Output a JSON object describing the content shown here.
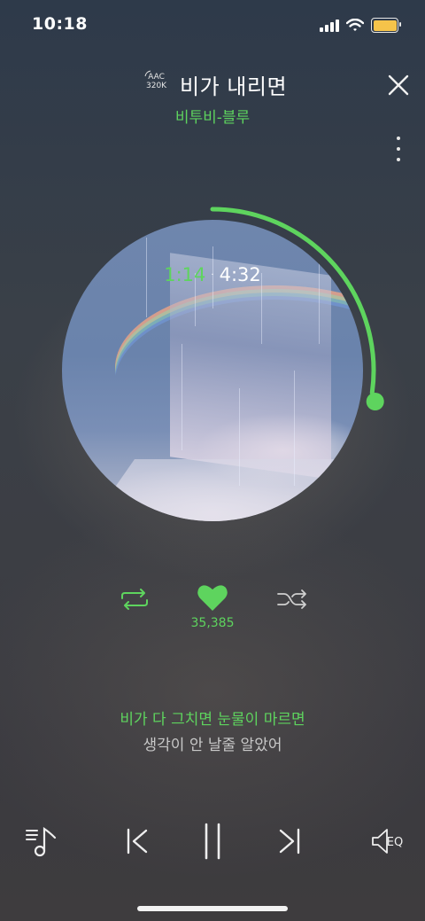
{
  "status_bar": {
    "time": "10:18",
    "battery_color": "#f5c34a"
  },
  "header": {
    "quality_codec": "AAC",
    "quality_bitrate": "320K",
    "song_title": "비가 내리면",
    "artist": "비투비-블루"
  },
  "player": {
    "current_time": "1:14",
    "separator": "·",
    "total_time": "4:32",
    "progress_fraction": 0.272,
    "accent_color": "#5ed45e"
  },
  "actions": {
    "repeat_icon": "repeat-icon",
    "like_icon": "heart-icon",
    "like_count": "35,385",
    "shuffle_icon": "shuffle-icon"
  },
  "lyrics": {
    "current_line": "비가 다 그치면 눈물이 마르면",
    "next_line": "생각이 안 날줄 알았어"
  },
  "bottom_controls": {
    "playlist_icon": "playlist-icon",
    "prev_icon": "previous-icon",
    "pause_icon": "pause-icon",
    "next_icon": "next-icon",
    "eq_label": "EQ"
  }
}
